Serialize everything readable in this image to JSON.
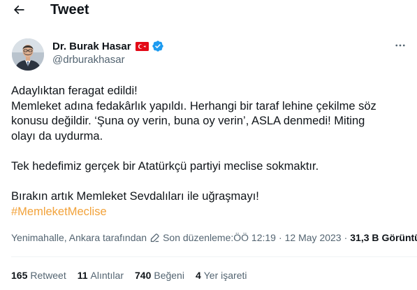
{
  "header": {
    "title": "Tweet",
    "back_icon": "arrow-left-icon"
  },
  "author": {
    "display_name": "Dr. Burak Hasar",
    "handle": "@drburakhasar",
    "flag_icon": "turkey-flag-icon",
    "verified_icon": "verified-badge-icon",
    "verified_color": "#1d9bf0",
    "more_icon": "more-horizontal-icon"
  },
  "tweet": {
    "lines": [
      "Adaylıktan feragat edildi!",
      "Memleket adına fedakârlık yapıldı. Herhangi bir taraf lehine çekilme söz",
      "konusu değildir. ‘Şuna oy verin, buna oy verin’, ASLA denmedi! Miting",
      "olayı da uydurma."
    ],
    "paragraph2": "Tek hedefimiz gerçek bir Atatürkçü partiyi meclise sokmaktır.",
    "paragraph3": "Bırakın artık Memleket Sevdalıları ile uğraşmayı!",
    "hashtag": "#MemleketMeclise",
    "hashtag_color": "#f2a23a"
  },
  "meta": {
    "location": "Yenimahalle, Ankara tarafından",
    "edit_icon": "pencil-icon",
    "edited_label": "Son düzenleme:",
    "time": "ÖÖ 12:19",
    "separator": "·",
    "date": "12 May 2023",
    "views_count": "31,3 B",
    "views_label": "Görüntülenme"
  },
  "stats": {
    "retweets_count": "165",
    "retweets_label": "Retweet",
    "quotes_count": "11",
    "quotes_label": "Alıntılar",
    "likes_count": "740",
    "likes_label": "Beğeni",
    "bookmarks_count": "4",
    "bookmarks_label": "Yer işareti"
  }
}
